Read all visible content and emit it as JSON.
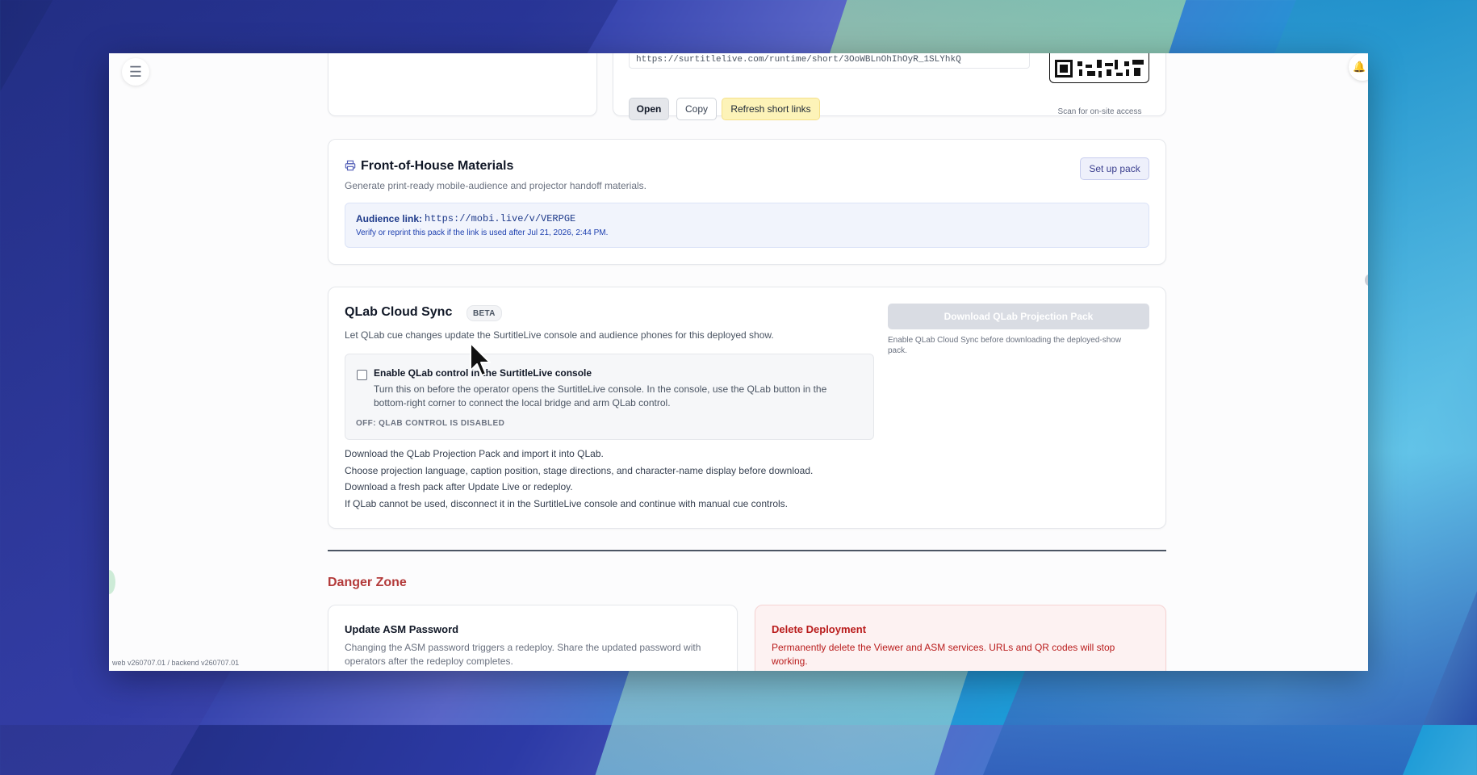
{
  "top_row": {
    "url_value": "https://surtitlelive.com/runtime/short/3OoWBLnOhIhOyR_1SLYhkQ",
    "open_label": "Open",
    "copy_label": "Copy",
    "refresh_label": "Refresh short links",
    "qr_caption": "Scan for on-site access"
  },
  "foh": {
    "icon": "printer-icon",
    "title": "Front-of-House Materials",
    "subtitle": "Generate print-ready mobile-audience and projector handoff materials.",
    "setup_label": "Set up pack",
    "audience_link_label": "Audience link:",
    "audience_link_url": "https://mobi.live/v/VERPGE",
    "note": "Verify or reprint this pack if the link is used after Jul 21, 2026, 2:44 PM."
  },
  "qlab": {
    "title": "QLab Cloud Sync",
    "badge": "BETA",
    "subtitle": "Let QLab cue changes update the SurtitleLive console and audience phones for this deployed show.",
    "checkbox_label": "Enable QLab control in the SurtitleLive console",
    "checkbox_desc": "Turn this on before the operator opens the SurtitleLive console. In the console, use the QLab button in the bottom-right corner to connect the local bridge and arm QLab control.",
    "status": "OFF: QLAB CONTROL IS DISABLED",
    "steps": [
      "Download the QLab Projection Pack and import it into QLab.",
      "Choose projection language, caption position, stage directions, and character-name display before download.",
      "Download a fresh pack after Update Live or redeploy.",
      "If QLab cannot be used, disconnect it in the SurtitleLive console and continue with manual cue controls."
    ],
    "download_label": "Download QLab Projection Pack",
    "download_note": "Enable QLab Cloud Sync before downloading the deployed-show pack."
  },
  "danger": {
    "title": "Danger Zone",
    "asm_title": "Update ASM Password",
    "asm_desc": "Changing the ASM password triggers a redeploy. Share the updated password with operators after the redeploy completes.",
    "delete_title": "Delete Deployment",
    "delete_desc": "Permanently delete the Viewer and ASM services. URLs and QR codes will stop working."
  },
  "footer": {
    "version": "web v260707.01 / backend v260707.01"
  },
  "icons": {
    "menu": "menu-icon",
    "bell": "bell-icon",
    "cursor": "mouse-cursor"
  },
  "colors": {
    "accent": "#4f5bb5",
    "danger": "#b33a3a",
    "refresh_bg": "#fdf3b8",
    "link_box_bg": "#f1f4fc"
  }
}
